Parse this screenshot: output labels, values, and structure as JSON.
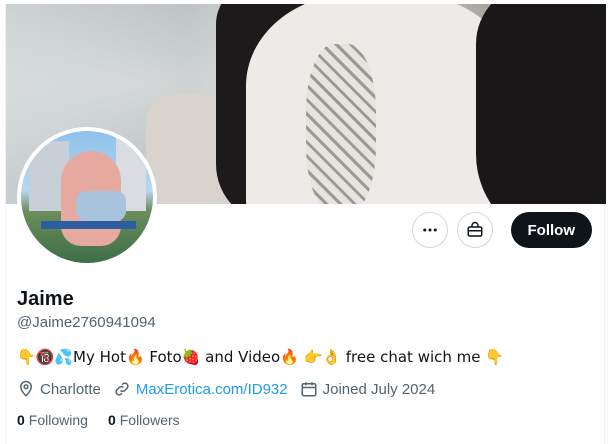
{
  "profile": {
    "name": "Jaime",
    "handle": "@Jaime2760941094",
    "bio": "👇🔞💦My Hot🔥 Foto🍓 and Video🔥 👉👌 free chat wich me 👇",
    "location": "Charlotte",
    "website": "MaxErotica.com/ID932",
    "joined": "Joined July 2024"
  },
  "actions": {
    "follow_label": "Follow",
    "more_icon": "more-horizontal-icon",
    "subscribe_icon": "shopping-bag-icon"
  },
  "stats": {
    "following_count": "0",
    "following_label": "Following",
    "followers_count": "0",
    "followers_label": "Followers"
  },
  "meta_icons": {
    "location": "location-pin-icon",
    "website": "link-icon",
    "joined": "calendar-icon"
  },
  "colors": {
    "accent": "#1d9bf0",
    "text": "#0f1419",
    "secondary": "#536471",
    "button_dark": "#0f1419"
  }
}
